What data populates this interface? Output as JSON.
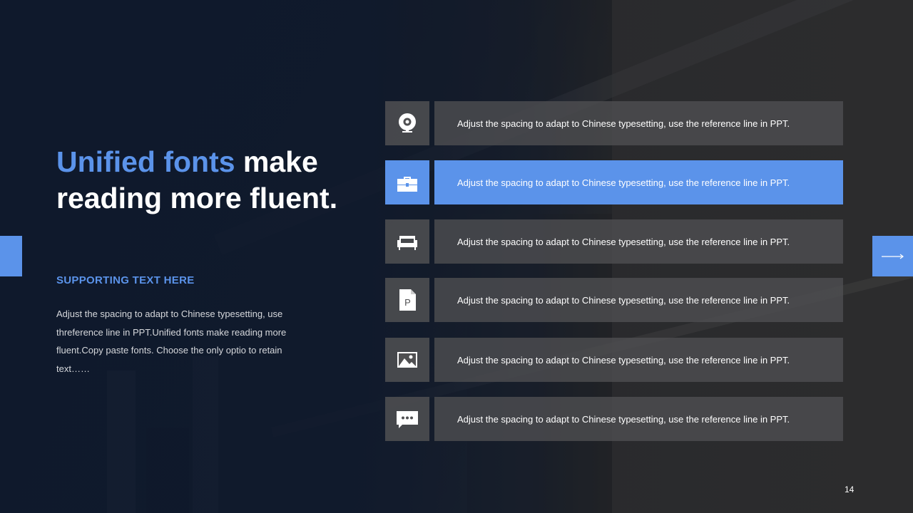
{
  "slide": {
    "title_accent": "Unified fonts",
    "title_rest": " make reading more fluent.",
    "subtitle": "SUPPORTING TEXT HERE",
    "paragraph": "Adjust the spacing to adapt to Chinese typesetting, use threference line in PPT.Unified fonts make reading more fluent.Copy paste fonts. Choose the only optio to retain text……",
    "page_number": "14"
  },
  "list": {
    "active_index": 1,
    "items": [
      {
        "icon": "webcam-icon",
        "text": "Adjust the spacing to adapt to Chinese typesetting, use the reference line in PPT."
      },
      {
        "icon": "toolbox-icon",
        "text": "Adjust the spacing to adapt to Chinese typesetting, use the reference line in PPT."
      },
      {
        "icon": "armchair-icon",
        "text": "Adjust the spacing to adapt to Chinese typesetting, use the reference line in PPT."
      },
      {
        "icon": "file-p-icon",
        "text": "Adjust the spacing to adapt to Chinese typesetting, use the reference line in PPT."
      },
      {
        "icon": "image-icon",
        "text": "Adjust the spacing to adapt to Chinese typesetting, use the reference line in PPT."
      },
      {
        "icon": "chat-bubble-icon",
        "text": "Adjust the spacing to adapt to Chinese typesetting, use the reference line in PPT."
      }
    ]
  },
  "icon_glyphs": {
    "file_letter": "P"
  },
  "colors": {
    "accent": "#5b93ea",
    "navy": "#14223c",
    "row_bg": "#505052"
  }
}
